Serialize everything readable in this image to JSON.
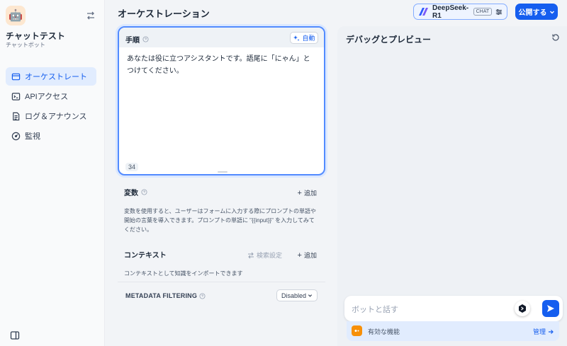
{
  "app": {
    "name": "チャットテスト",
    "type": "チャットボット",
    "icon": "robot-icon"
  },
  "nav": {
    "items": [
      {
        "label": "オーケストレート",
        "icon": "window-icon",
        "active": true
      },
      {
        "label": "APIアクセス",
        "icon": "terminal-icon",
        "active": false
      },
      {
        "label": "ログ＆アナウンス",
        "icon": "document-icon",
        "active": false
      },
      {
        "label": "監視",
        "icon": "gauge-icon",
        "active": false
      }
    ]
  },
  "header": {
    "title": "オーケストレーション",
    "model_name": "DeepSeek-R1",
    "model_mode": "CHAT",
    "publish_label": "公開する"
  },
  "prompt": {
    "title": "手順",
    "auto_label": "自動",
    "text": "あなたは役に立つアシスタントです。語尾に「にゃん」とつけてください。",
    "char_count": "34"
  },
  "variables": {
    "title": "変数",
    "add_label": "追加",
    "description": "変数を使用すると、ユーザーはフォームに入力する際にプロンプトの単語や開始の言葉を導入できます。プロンプトの単語に \"{{input}}\" を入力してみてください。"
  },
  "context": {
    "title": "コンテキスト",
    "retrieval_label": "検索設定",
    "add_label": "追加",
    "description": "コンテキストとして知識をインポートできます",
    "metadata_label": "METADATA FILTERING",
    "metadata_value": "Disabled"
  },
  "preview": {
    "title": "デバッグとプレビュー",
    "input_placeholder": "ボットと話す",
    "features_label": "有効な機能",
    "manage_label": "管理"
  },
  "colors": {
    "accent": "#155eef",
    "active_nav_bg": "#e1ecfe"
  }
}
